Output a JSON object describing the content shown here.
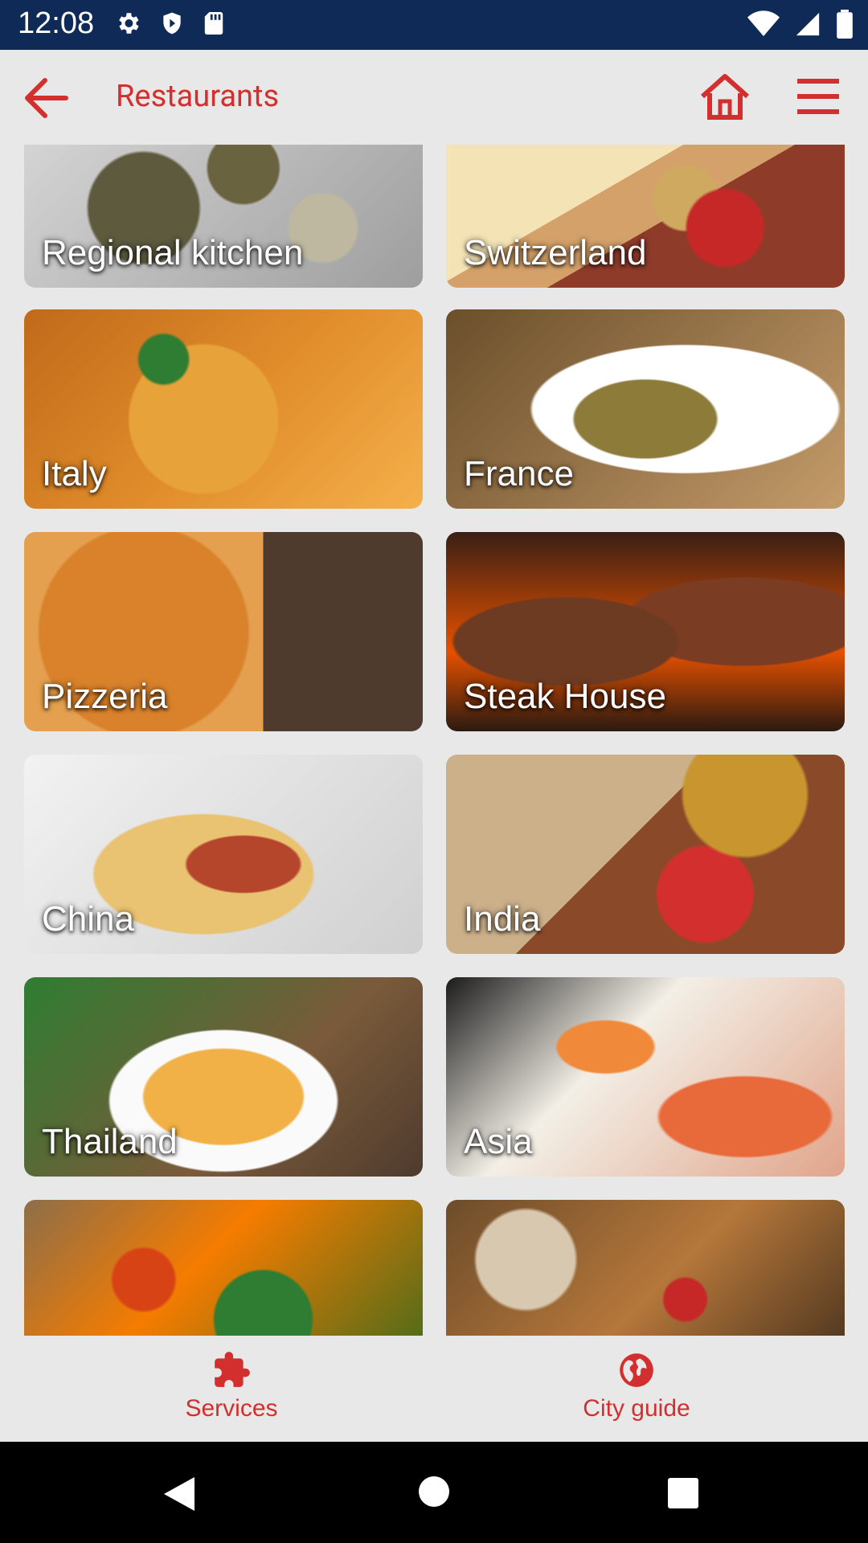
{
  "status_bar": {
    "time": "12:08",
    "left_icons": [
      "settings-icon",
      "shield-icon",
      "sd-card-icon"
    ],
    "right_icons": [
      "wifi-icon",
      "cellular-signal-icon",
      "battery-icon"
    ]
  },
  "app_bar": {
    "title": "Restaurants",
    "back_icon": "arrow-left-icon",
    "home_icon": "home-icon",
    "menu_icon": "hamburger-menu-icon",
    "accent_color": "#d32f2f"
  },
  "categories": [
    {
      "label": "Regional kitchen"
    },
    {
      "label": "Switzerland"
    },
    {
      "label": "Italy"
    },
    {
      "label": "France"
    },
    {
      "label": "Pizzeria"
    },
    {
      "label": "Steak House"
    },
    {
      "label": "China"
    },
    {
      "label": "India"
    },
    {
      "label": "Thailand"
    },
    {
      "label": "Asia"
    },
    {
      "label": ""
    },
    {
      "label": ""
    }
  ],
  "bottom_nav": {
    "services": {
      "label": "Services",
      "icon": "puzzle-icon"
    },
    "city_guide": {
      "label": "City guide",
      "icon": "globe-icon"
    }
  },
  "system_nav": {
    "icons": [
      "back-triangle-icon",
      "home-circle-icon",
      "recents-square-icon"
    ]
  }
}
